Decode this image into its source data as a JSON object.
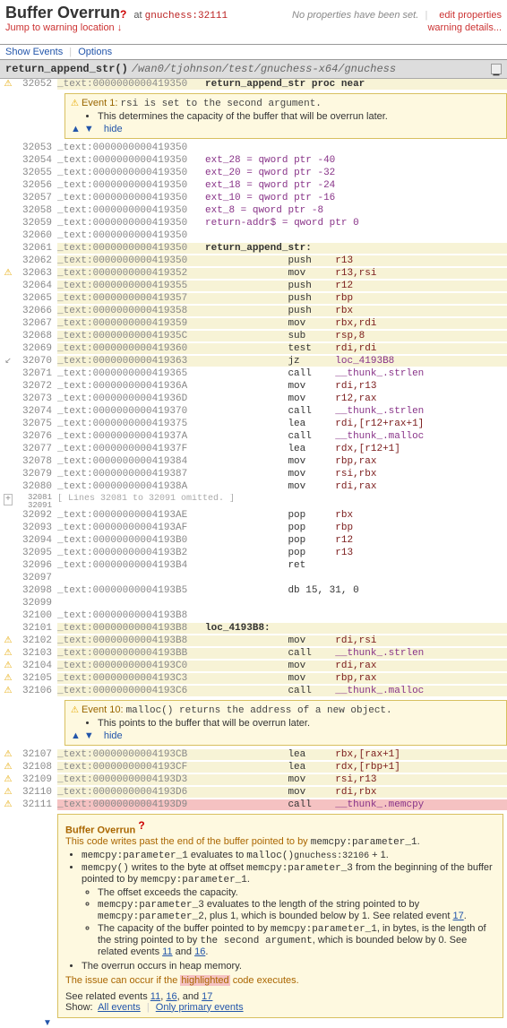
{
  "header": {
    "title": "Buffer Overrun",
    "at_prefix": "at",
    "at_location": "gnuchess:32111",
    "no_props": "No properties have been set.",
    "edit_props": "edit properties",
    "jump_warning": "Jump to warning location ↓",
    "warning_details": "warning details..."
  },
  "nav": {
    "show_events": "Show Events",
    "options": "Options"
  },
  "path_bar": {
    "func": "return_append_str",
    "path": "/wan0/tjohnson/test/gnuchess-x64/gnuchess"
  },
  "event1": {
    "title": "Event 1:",
    "body": "rsi is set to the second argument.",
    "bullet": "This determines the capacity of the buffer that will be overrun later.",
    "hide": "hide"
  },
  "event10": {
    "title": "Event 10:",
    "body": "malloc() returns the address of a new object.",
    "bullet": "This points to the buffer that will be overrun later.",
    "hide": "hide"
  },
  "omitted": {
    "text": "[ Lines 32081 to 32091 omitted. ]"
  },
  "asm": {
    "header_comment": "return_append_str proc near",
    "ext28": "ext_28 = qword ptr -40",
    "ext20": "ext_20 = qword ptr -32",
    "ext18": "ext_18 = qword ptr -24",
    "ext10": "ext_10 = qword ptr -16",
    "ext8": "ext_8 = qword ptr -8",
    "ret": "return-addr$ = qword ptr 0",
    "label_ras": "return_append_str:",
    "label_loc": "loc_4193B8:",
    "db": "db 15, 31, 0"
  },
  "details": {
    "title": "Buffer Overrun",
    "intro": "This code writes past the end of the buffer pointed to by",
    "p1": "memcpy:parameter_1",
    "eval_to": "evaluates to",
    "malloc": "malloc()",
    "gnuchess_ref": "gnuchess:32106",
    "plus1": "+ 1.",
    "memcpy": "memcpy()",
    "writes": "writes to the byte at offset",
    "p3": "memcpy:parameter_3",
    "from_beg": "from the beginning of the buffer pointed to by",
    "off_exc": "The offset exceeds the capacity.",
    "p3_eval": "evaluates to the length of the string pointed to by",
    "p2": "memcpy:parameter_2",
    "bounded1": ", plus 1, which is bounded below by 1.  See related event",
    "ev17": "17",
    "cap_intro": "The capacity of the buffer pointed to by",
    "cap_mid": ", in bytes, is the length of the string pointed to by",
    "second_arg": "the second argument",
    "bounded0": ", which is bounded below by 0.  See related events",
    "ev11": "11",
    "and": "and",
    "ev16": "16",
    "heap": "The overrun occurs in heap memory.",
    "issue": "The issue can occur if the",
    "highlighted": "highlighted",
    "executes": "code executes.",
    "see_related": "See related events",
    "show": "Show:",
    "all_events": "All events",
    "only_primary": "Only primary events"
  },
  "lines": [
    {
      "n": "32052",
      "g": "warn",
      "a": "_text:0000000000419350",
      "rest": "   return_append_str proc near",
      "hl": "y",
      "bold": true
    },
    {
      "event": 1
    },
    {
      "n": "32053",
      "a": "_text:0000000000419350"
    },
    {
      "n": "32054",
      "a": "_text:0000000000419350",
      "dir": "ext_28 = qword ptr -40"
    },
    {
      "n": "32055",
      "a": "_text:0000000000419350",
      "dir": "ext_20 = qword ptr -32"
    },
    {
      "n": "32056",
      "a": "_text:0000000000419350",
      "dir": "ext_18 = qword ptr -24"
    },
    {
      "n": "32057",
      "a": "_text:0000000000419350",
      "dir": "ext_10 = qword ptr -16"
    },
    {
      "n": "32058",
      "a": "_text:0000000000419350",
      "dir": "ext_8 = qword ptr -8"
    },
    {
      "n": "32059",
      "a": "_text:0000000000419350",
      "dir": "return-addr$ = qword ptr 0"
    },
    {
      "n": "32060",
      "a": "_text:0000000000419350"
    },
    {
      "n": "32061",
      "a": "_text:0000000000419350",
      "rest": "   return_append_str:",
      "hl": "y",
      "bold": true
    },
    {
      "n": "32062",
      "a": "_text:0000000000419350",
      "m": "push",
      "o": "r13",
      "hl": "y"
    },
    {
      "n": "32063",
      "g": "warn",
      "a": "_text:0000000000419352",
      "m": "mov",
      "o": "r13,rsi",
      "hl": "y",
      "ul": true
    },
    {
      "n": "32064",
      "a": "_text:0000000000419355",
      "m": "push",
      "o": "r12",
      "hl": "y",
      "ul": true
    },
    {
      "n": "32065",
      "a": "_text:0000000000419357",
      "m": "push",
      "o": "rbp",
      "hl": "y"
    },
    {
      "n": "32066",
      "a": "_text:0000000000419358",
      "m": "push",
      "o": "rbx",
      "hl": "y"
    },
    {
      "n": "32067",
      "a": "_text:0000000000419359",
      "m": "mov",
      "o": "rbx,rdi",
      "hl": "y",
      "ul": true
    },
    {
      "n": "32068",
      "a": "_text:000000000041935C",
      "m": "sub",
      "o": "rsp,8",
      "hl": "y"
    },
    {
      "n": "32069",
      "a": "_text:0000000000419360",
      "m": "test",
      "o": "rdi,rdi",
      "hl": "y"
    },
    {
      "n": "32070",
      "g": "darr",
      "a": "_text:0000000000419363",
      "m": "jz",
      "o": "loc_4193B8",
      "hl": "y",
      "fn": true
    },
    {
      "n": "32071",
      "a": "_text:0000000000419365",
      "m": "call",
      "o": "__thunk_.strlen",
      "fn": true
    },
    {
      "n": "32072",
      "a": "_text:000000000041936A",
      "m": "mov",
      "o": "rdi,r13"
    },
    {
      "n": "32073",
      "a": "_text:000000000041936D",
      "m": "mov",
      "o": "r12,rax",
      "ul": true
    },
    {
      "n": "32074",
      "a": "_text:0000000000419370",
      "m": "call",
      "o": "__thunk_.strlen",
      "fn": true
    },
    {
      "n": "32075",
      "a": "_text:0000000000419375",
      "m": "lea",
      "o": "rdi,[r12+rax+1]",
      "ul": true
    },
    {
      "n": "32076",
      "a": "_text:000000000041937A",
      "m": "call",
      "o": "__thunk_.malloc",
      "fn": true
    },
    {
      "n": "32077",
      "a": "_text:000000000041937F",
      "m": "lea",
      "o": "rdx,[r12+1]",
      "ul": true
    },
    {
      "n": "32078",
      "a": "_text:0000000000419384",
      "m": "mov",
      "o": "rbp,rax",
      "ul": true
    },
    {
      "n": "32079",
      "a": "_text:0000000000419387",
      "m": "mov",
      "o": "rsi,rbx",
      "ul": true
    },
    {
      "n": "32080",
      "a": "_text:000000000041938A",
      "m": "mov",
      "o": "rdi,rax",
      "ul": true
    },
    {
      "omit": true
    },
    {
      "n": "32092",
      "a": "_text:00000000004193AE",
      "m": "pop",
      "o": "rbx"
    },
    {
      "n": "32093",
      "a": "_text:00000000004193AF",
      "m": "pop",
      "o": "rbp"
    },
    {
      "n": "32094",
      "a": "_text:00000000004193B0",
      "m": "pop",
      "o": "r12"
    },
    {
      "n": "32095",
      "a": "_text:00000000004193B2",
      "m": "pop",
      "o": "r13"
    },
    {
      "n": "32096",
      "a": "_text:00000000004193B4",
      "m": "ret",
      "o": ""
    },
    {
      "n": "32097",
      "a": ""
    },
    {
      "n": "32098",
      "a": "_text:00000000004193B5",
      "rest": "                 db 15, 31, 0"
    },
    {
      "n": "32099",
      "a": ""
    },
    {
      "n": "32100",
      "a": "_text:00000000004193B8"
    },
    {
      "n": "32101",
      "a": "_text:00000000004193B8",
      "rest": "   loc_4193B8:",
      "hl": "y",
      "bold": true
    },
    {
      "n": "32102",
      "g": "warn",
      "a": "_text:00000000004193B8",
      "m": "mov",
      "o": "rdi,rsi",
      "hl": "y",
      "ul": true
    },
    {
      "n": "32103",
      "g": "warn",
      "a": "_text:00000000004193BB",
      "m": "call",
      "o": "__thunk_.strlen",
      "hl": "y",
      "fn": true
    },
    {
      "n": "32104",
      "g": "warn",
      "a": "_text:00000000004193C0",
      "m": "mov",
      "o": "rdi,rax",
      "hl": "y",
      "ul": true
    },
    {
      "n": "32105",
      "g": "warn",
      "a": "_text:00000000004193C3",
      "m": "mov",
      "o": "rbp,rax",
      "hl": "y",
      "ul": true
    },
    {
      "n": "32106",
      "g": "warn",
      "a": "_text:00000000004193C6",
      "m": "call",
      "o": "__thunk_.malloc",
      "hl": "y",
      "fn": true
    },
    {
      "event": 10
    },
    {
      "n": "32107",
      "g": "warn",
      "a": "_text:00000000004193CB",
      "m": "lea",
      "o": "rbx,[rax+1]",
      "hl": "y",
      "ul": true
    },
    {
      "n": "32108",
      "g": "warn",
      "a": "_text:00000000004193CF",
      "m": "lea",
      "o": "rdx,[rbp+1]",
      "hl": "y",
      "ul": true
    },
    {
      "n": "32109",
      "g": "warn",
      "a": "_text:00000000004193D3",
      "m": "mov",
      "o": "rsi,r13",
      "hl": "y",
      "ul": true
    },
    {
      "n": "32110",
      "g": "warn",
      "a": "_text:00000000004193D6",
      "m": "mov",
      "o": "rdi,rbx",
      "hl": "y",
      "ul": true
    },
    {
      "n": "32111",
      "g": "warn",
      "a": "_text:00000000004193D9",
      "m": "call",
      "o": "__thunk_.memcpy",
      "hl": "r",
      "fn": true
    }
  ]
}
